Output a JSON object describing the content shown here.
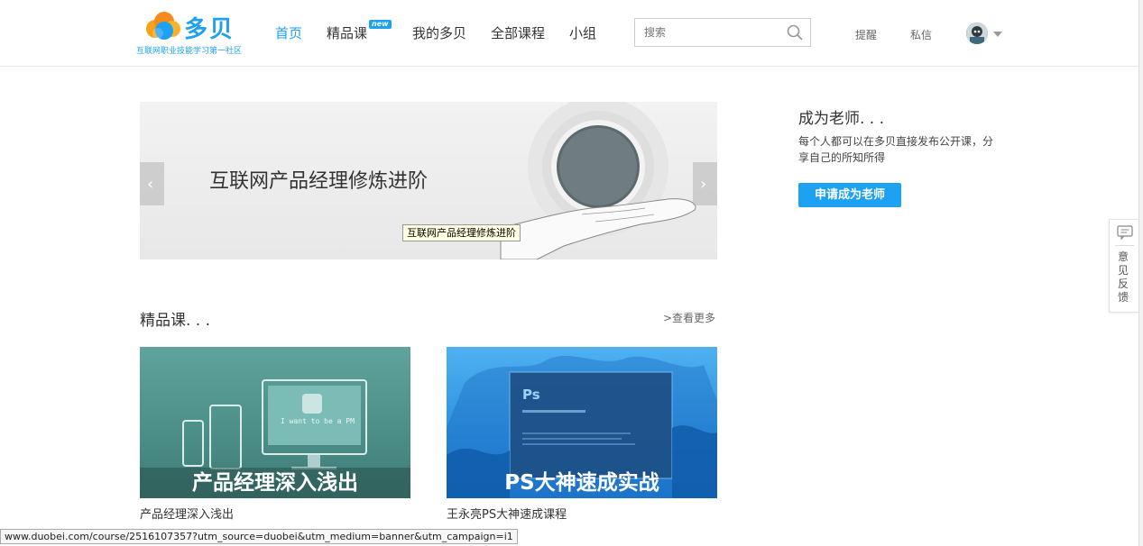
{
  "brand": {
    "logo_name": "多贝",
    "tagline": "互联网职业技能学习第一社区",
    "color": "#1da1f2"
  },
  "nav": {
    "items": [
      {
        "label": "首页",
        "active": true
      },
      {
        "label": "精品课",
        "badge": "new"
      },
      {
        "label": "我的多贝"
      },
      {
        "label": "全部课程"
      },
      {
        "label": "小组"
      }
    ]
  },
  "search": {
    "placeholder": "搜索",
    "icon": "search-icon"
  },
  "header_links": {
    "remind": "提醒",
    "messages": "私信"
  },
  "banner": {
    "title": "互联网产品经理修炼进阶",
    "tooltip": "互联网产品经理修炼进阶",
    "prev_icon": "chevron-left-icon",
    "next_icon": "chevron-right-icon"
  },
  "teacher": {
    "title": "成为老师. . .",
    "description": "每个人都可以在多贝直接发布公开课，分享自己的所知所得",
    "button": "申请成为老师"
  },
  "feedback": {
    "label": "意见反馈",
    "icon": "chat-icon"
  },
  "featured": {
    "title": "精品课. . .",
    "more": ">查看更多",
    "courses": [
      {
        "image_caption": "产品经理深入浅出",
        "image_subtext": "I want to be a PM",
        "name": "产品经理深入浅出"
      },
      {
        "image_caption": "PS大神速成实战",
        "image_subtext": "Ps",
        "name": "王永亮PS大神速成课程"
      }
    ]
  },
  "status_bar": {
    "url": "www.duobei.com/course/2516107357?utm_source=duobei&utm_medium=banner&utm_campaign=i1"
  }
}
